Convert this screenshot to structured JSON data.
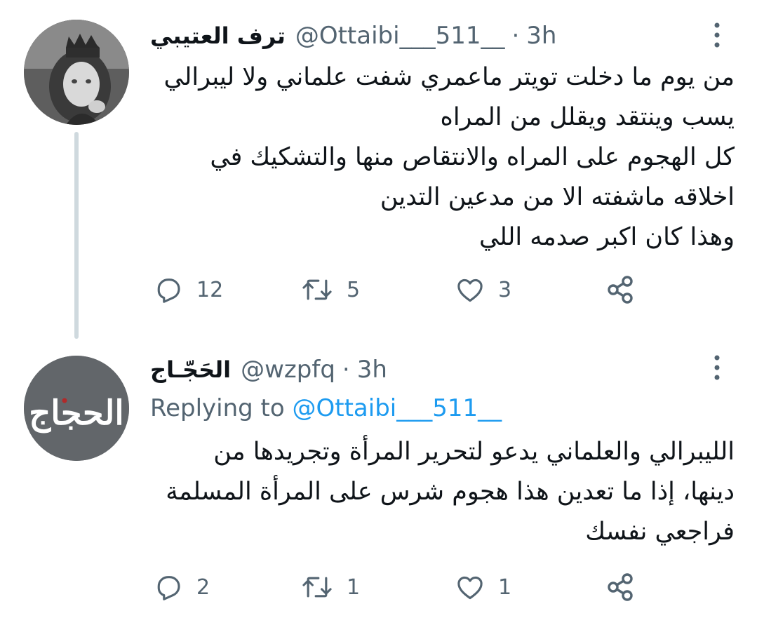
{
  "tweets": [
    {
      "display_name": "ترف العتيبي",
      "handle": "@Ottaibi___511__",
      "separator": "·",
      "time": "3h",
      "lines": [
        "من يوم ما دخلت تويتر ماعمري شفت علماني ولا ليبرالي",
        "يسب وينتقد ويقلل من المراه",
        "كل الهجوم على المراه والانتقاص منها والتشكيك في",
        "اخلاقه ماشفته الا من مدعين التدين",
        "وهذا كان اكبر صدمه اللي"
      ],
      "stats": {
        "replies": "12",
        "retweets": "5",
        "likes": "3"
      }
    },
    {
      "display_name": "الحَجّـاج",
      "handle": "@wzpfq",
      "separator": "·",
      "time": "3h",
      "replying_prefix": "Replying to",
      "replying_to": "@Ottaibi___511__",
      "avatar_text": "الحجاج",
      "lines": [
        "الليبرالي والعلماني يدعو لتحرير المرأة وتجريدها من",
        "دينها، إذا ما تعدين هذا هجوم شرس على المرأة المسلمة",
        "فراجعي نفسك"
      ],
      "stats": {
        "replies": "2",
        "retweets": "1",
        "likes": "1"
      }
    }
  ],
  "icons": {
    "reply": "reply-icon",
    "retweet": "retweet-icon",
    "like": "heart-icon",
    "share": "share-icon",
    "more": "more-vertical-icon"
  },
  "colors": {
    "text": "#0f1419",
    "secondary": "#536471",
    "link": "#1d9bf0",
    "thread_line": "#cfd9de"
  }
}
